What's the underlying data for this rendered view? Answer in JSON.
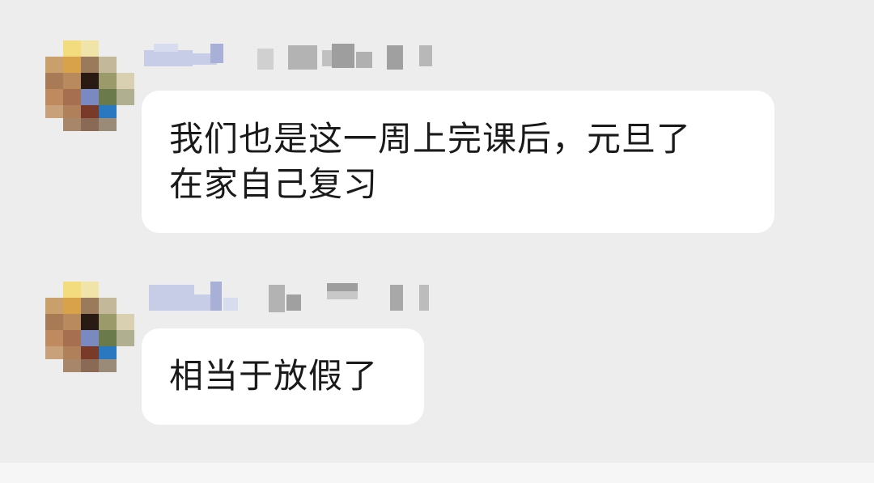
{
  "conversation": {
    "messages": [
      {
        "lines": [
          "我们也是这一周上完课后，元旦了",
          "在家自己复习"
        ]
      },
      {
        "lines": [
          "相当于放假了"
        ]
      }
    ]
  },
  "colors": {
    "chat_background": "#ededed",
    "bubble_background": "#ffffff",
    "text": "#1a1a1a",
    "name_blur_primary": "#c7cde6",
    "name_blur_secondary": "#b3b3b3"
  },
  "icons": {
    "avatar": "pixelated-avatar-icon",
    "sender_name": "blurred-name"
  }
}
